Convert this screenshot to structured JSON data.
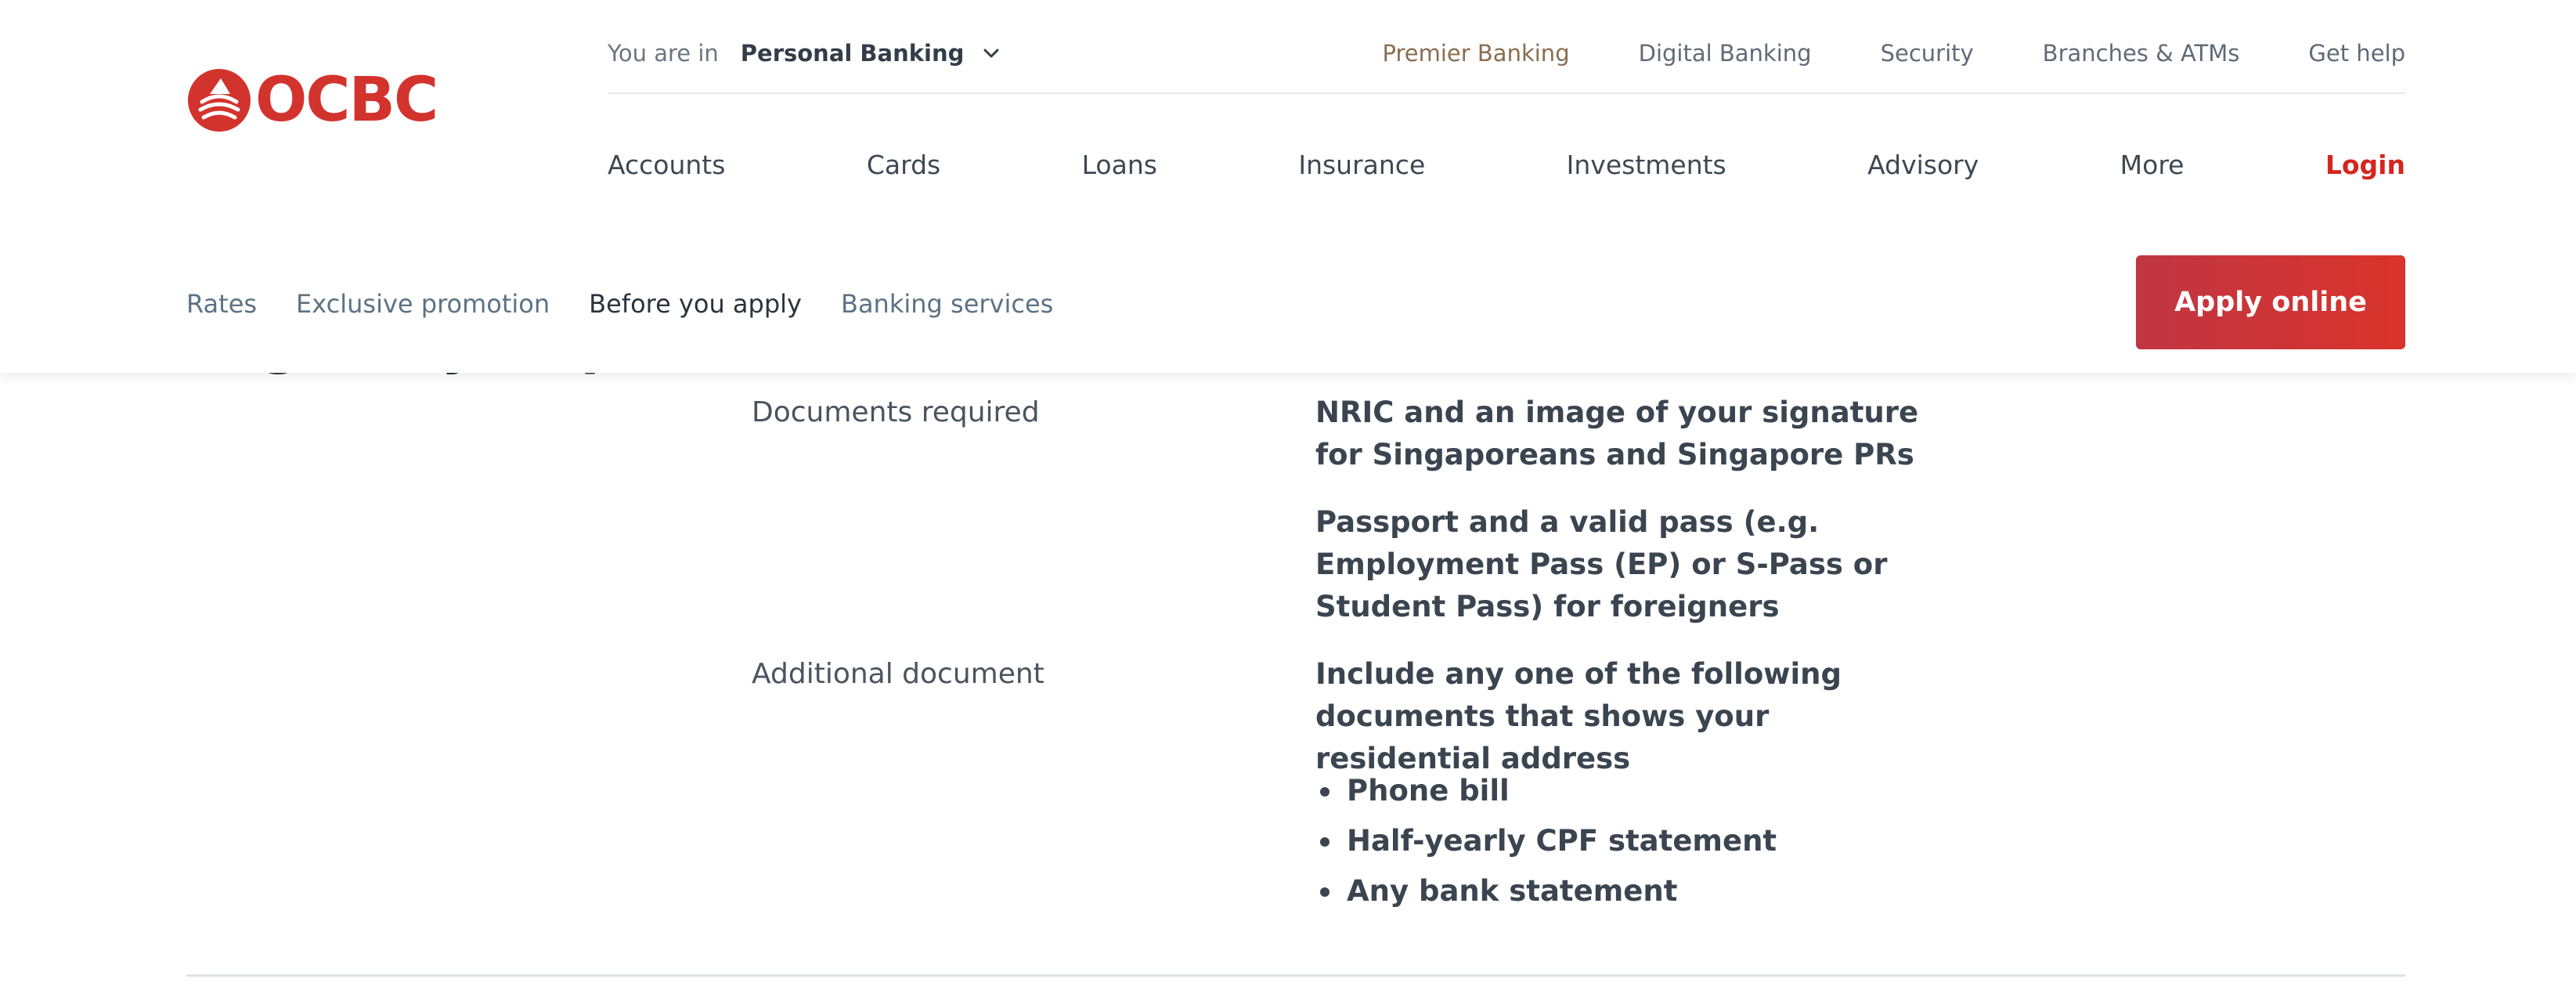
{
  "brand": {
    "name": "OCBC",
    "color": "#d3332d",
    "icon": "ocbc-sail-logo-icon"
  },
  "segment": {
    "prefix": "You are in",
    "value": "Personal Banking",
    "icon": "chevron-down-icon"
  },
  "utility_links": [
    "Premier Banking",
    "Digital Banking",
    "Security",
    "Branches & ATMs",
    "Get help"
  ],
  "main_nav": [
    "Accounts",
    "Cards",
    "Loans",
    "Insurance",
    "Investments",
    "Advisory",
    "More"
  ],
  "login_label": "Login",
  "sub_nav": {
    "items": [
      "Rates",
      "Exclusive promotion",
      "Before you apply",
      "Banking services"
    ],
    "active": "Before you apply"
  },
  "apply_button": {
    "label": "Apply online",
    "gradient_from": "#c03643",
    "gradient_to": "#d9332b"
  },
  "content": {
    "rows": [
      {
        "label": "Documents required",
        "paragraphs": [
          "NRIC and an image of your signature for Singaporeans and Singapore PRs",
          "Passport and a valid pass (e.g. Employment Pass (EP) or S-Pass or Student Pass) for foreigners"
        ]
      },
      {
        "label": "Additional document",
        "paragraphs": [
          "Include any one of the following documents that shows your residential address"
        ],
        "bullets": [
          "Phone bill",
          "Half-yearly CPF statement",
          "Any bank statement"
        ]
      }
    ]
  },
  "colors": {
    "accent_red": "#d6251f",
    "premier_gold": "#8a6d4f",
    "subnav_link": "#5c7285"
  }
}
